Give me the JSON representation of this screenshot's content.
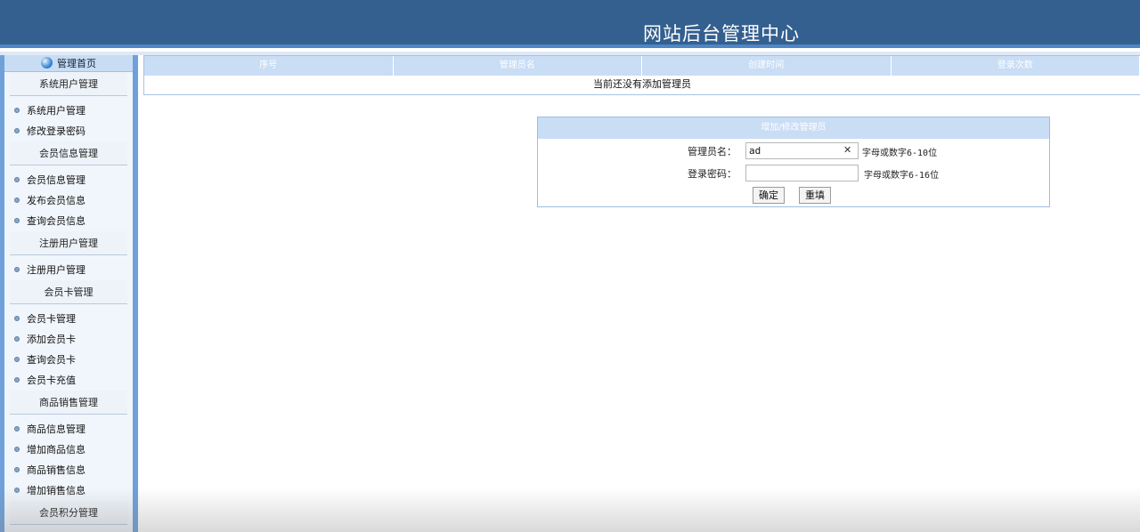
{
  "header": {
    "title": "网站后台管理中心"
  },
  "sidebar": {
    "home": "管理首页",
    "groups": [
      {
        "title": "系统用户管理",
        "items": [
          "系统用户管理",
          "修改登录密码"
        ]
      },
      {
        "title": "会员信息管理",
        "items": [
          "会员信息管理",
          "发布会员信息",
          "查询会员信息"
        ]
      },
      {
        "title": "注册用户管理",
        "items": [
          "注册用户管理"
        ]
      },
      {
        "title": "会员卡管理",
        "items": [
          "会员卡管理",
          "添加会员卡",
          "查询会员卡",
          "会员卡充值"
        ]
      },
      {
        "title": "商品销售管理",
        "items": [
          "商品信息管理",
          "增加商品信息",
          "商品销售信息",
          "增加销售信息"
        ]
      },
      {
        "title": "会员积分管理",
        "items": []
      }
    ]
  },
  "table": {
    "columns": [
      "序号",
      "管理员名",
      "创建时间",
      "登录次数"
    ],
    "empty_message": "当前还没有添加管理员"
  },
  "form": {
    "title": "增加/修改管理员",
    "username_label": "管理员名：",
    "username_value": "ad",
    "username_hint": "字母或数字6-10位",
    "password_label": "登录密码：",
    "password_value": "",
    "password_hint": "字母或数字6-16位",
    "submit_label": "确定",
    "reset_label": "重填"
  },
  "icons": {
    "home": "globe-icon",
    "menu_bullet": "bullet-dot-icon",
    "clear": "clear-x-icon"
  },
  "colors": {
    "header_bg": "#33608f",
    "sidebar_border": "#6fa0da",
    "table_header_bg": "#c9ddf5"
  }
}
